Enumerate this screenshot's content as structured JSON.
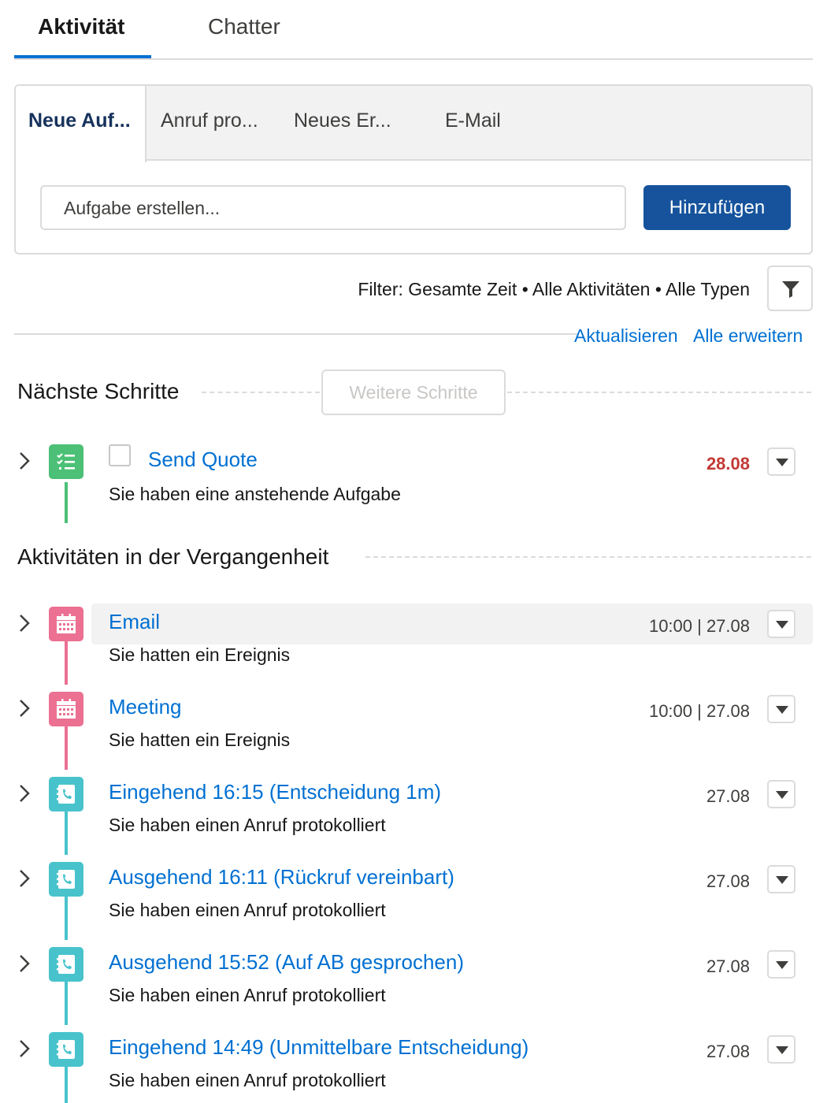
{
  "top_tabs": {
    "activity": "Aktivität",
    "chatter": "Chatter"
  },
  "composer": {
    "tabs": [
      "Neue Auf...",
      "Anruf pro...",
      "Neues Er...",
      "E-Mail"
    ],
    "input_placeholder": "Aufgabe erstellen...",
    "add_button": "Hinzufügen"
  },
  "filter": {
    "text": "Filter: Gesamte Zeit • Alle Aktivitäten • Alle Typen",
    "refresh": "Aktualisieren",
    "expand_all": "Alle erweitern"
  },
  "next_steps": {
    "title": "Nächste Schritte",
    "more_button": "Weitere Schritte",
    "items": [
      {
        "title": "Send Quote",
        "subtitle": "Sie haben eine anstehende Aufgabe",
        "date": "28.08",
        "icon": "task-icon",
        "color": "#4bc076"
      }
    ]
  },
  "past": {
    "title": "Aktivitäten in der Vergangenheit",
    "items": [
      {
        "title": "Email",
        "subtitle": "Sie hatten ein Ereignis",
        "date": "10:00 | 27.08",
        "icon": "event-icon",
        "color": "#eb7092"
      },
      {
        "title": "Meeting",
        "subtitle": "Sie hatten ein Ereignis",
        "date": "10:00 | 27.08",
        "icon": "event-icon",
        "color": "#eb7092"
      },
      {
        "title": "Eingehend 16:15 (Entscheidung 1m)",
        "subtitle": "Sie haben einen Anruf protokolliert",
        "date": "27.08",
        "icon": "call-icon",
        "color": "#48c3cc"
      },
      {
        "title": "Ausgehend 16:11 (Rückruf vereinbart)",
        "subtitle": "Sie haben einen Anruf protokolliert",
        "date": "27.08",
        "icon": "call-icon",
        "color": "#48c3cc"
      },
      {
        "title": "Ausgehend 15:52 (Auf AB gesprochen)",
        "subtitle": "Sie haben einen Anruf protokolliert",
        "date": "27.08",
        "icon": "call-icon",
        "color": "#48c3cc"
      },
      {
        "title": "Eingehend 14:49 (Unmittelbare Entscheidung)",
        "subtitle": "Sie haben einen Anruf protokolliert",
        "date": "27.08",
        "icon": "call-icon",
        "color": "#48c3cc"
      }
    ]
  },
  "colors": {
    "brand": "#16539c",
    "link": "#0070d2",
    "overdue": "#c23934"
  }
}
